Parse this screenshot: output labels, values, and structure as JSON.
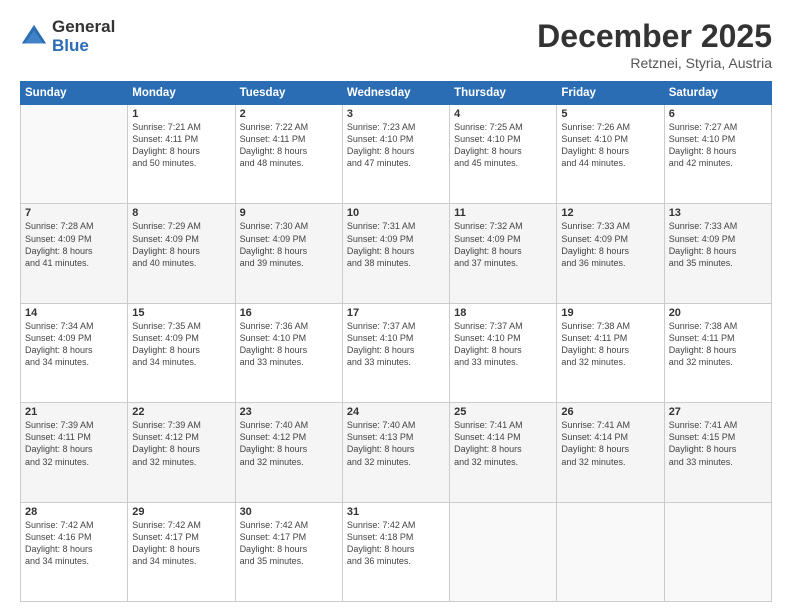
{
  "logo": {
    "general": "General",
    "blue": "Blue"
  },
  "header": {
    "month": "December 2025",
    "location": "Retznei, Styria, Austria"
  },
  "weekdays": [
    "Sunday",
    "Monday",
    "Tuesday",
    "Wednesday",
    "Thursday",
    "Friday",
    "Saturday"
  ],
  "weeks": [
    [
      {
        "day": "",
        "info": ""
      },
      {
        "day": "1",
        "info": "Sunrise: 7:21 AM\nSunset: 4:11 PM\nDaylight: 8 hours\nand 50 minutes."
      },
      {
        "day": "2",
        "info": "Sunrise: 7:22 AM\nSunset: 4:11 PM\nDaylight: 8 hours\nand 48 minutes."
      },
      {
        "day": "3",
        "info": "Sunrise: 7:23 AM\nSunset: 4:10 PM\nDaylight: 8 hours\nand 47 minutes."
      },
      {
        "day": "4",
        "info": "Sunrise: 7:25 AM\nSunset: 4:10 PM\nDaylight: 8 hours\nand 45 minutes."
      },
      {
        "day": "5",
        "info": "Sunrise: 7:26 AM\nSunset: 4:10 PM\nDaylight: 8 hours\nand 44 minutes."
      },
      {
        "day": "6",
        "info": "Sunrise: 7:27 AM\nSunset: 4:10 PM\nDaylight: 8 hours\nand 42 minutes."
      }
    ],
    [
      {
        "day": "7",
        "info": "Sunrise: 7:28 AM\nSunset: 4:09 PM\nDaylight: 8 hours\nand 41 minutes."
      },
      {
        "day": "8",
        "info": "Sunrise: 7:29 AM\nSunset: 4:09 PM\nDaylight: 8 hours\nand 40 minutes."
      },
      {
        "day": "9",
        "info": "Sunrise: 7:30 AM\nSunset: 4:09 PM\nDaylight: 8 hours\nand 39 minutes."
      },
      {
        "day": "10",
        "info": "Sunrise: 7:31 AM\nSunset: 4:09 PM\nDaylight: 8 hours\nand 38 minutes."
      },
      {
        "day": "11",
        "info": "Sunrise: 7:32 AM\nSunset: 4:09 PM\nDaylight: 8 hours\nand 37 minutes."
      },
      {
        "day": "12",
        "info": "Sunrise: 7:33 AM\nSunset: 4:09 PM\nDaylight: 8 hours\nand 36 minutes."
      },
      {
        "day": "13",
        "info": "Sunrise: 7:33 AM\nSunset: 4:09 PM\nDaylight: 8 hours\nand 35 minutes."
      }
    ],
    [
      {
        "day": "14",
        "info": "Sunrise: 7:34 AM\nSunset: 4:09 PM\nDaylight: 8 hours\nand 34 minutes."
      },
      {
        "day": "15",
        "info": "Sunrise: 7:35 AM\nSunset: 4:09 PM\nDaylight: 8 hours\nand 34 minutes."
      },
      {
        "day": "16",
        "info": "Sunrise: 7:36 AM\nSunset: 4:10 PM\nDaylight: 8 hours\nand 33 minutes."
      },
      {
        "day": "17",
        "info": "Sunrise: 7:37 AM\nSunset: 4:10 PM\nDaylight: 8 hours\nand 33 minutes."
      },
      {
        "day": "18",
        "info": "Sunrise: 7:37 AM\nSunset: 4:10 PM\nDaylight: 8 hours\nand 33 minutes."
      },
      {
        "day": "19",
        "info": "Sunrise: 7:38 AM\nSunset: 4:11 PM\nDaylight: 8 hours\nand 32 minutes."
      },
      {
        "day": "20",
        "info": "Sunrise: 7:38 AM\nSunset: 4:11 PM\nDaylight: 8 hours\nand 32 minutes."
      }
    ],
    [
      {
        "day": "21",
        "info": "Sunrise: 7:39 AM\nSunset: 4:11 PM\nDaylight: 8 hours\nand 32 minutes."
      },
      {
        "day": "22",
        "info": "Sunrise: 7:39 AM\nSunset: 4:12 PM\nDaylight: 8 hours\nand 32 minutes."
      },
      {
        "day": "23",
        "info": "Sunrise: 7:40 AM\nSunset: 4:12 PM\nDaylight: 8 hours\nand 32 minutes."
      },
      {
        "day": "24",
        "info": "Sunrise: 7:40 AM\nSunset: 4:13 PM\nDaylight: 8 hours\nand 32 minutes."
      },
      {
        "day": "25",
        "info": "Sunrise: 7:41 AM\nSunset: 4:14 PM\nDaylight: 8 hours\nand 32 minutes."
      },
      {
        "day": "26",
        "info": "Sunrise: 7:41 AM\nSunset: 4:14 PM\nDaylight: 8 hours\nand 32 minutes."
      },
      {
        "day": "27",
        "info": "Sunrise: 7:41 AM\nSunset: 4:15 PM\nDaylight: 8 hours\nand 33 minutes."
      }
    ],
    [
      {
        "day": "28",
        "info": "Sunrise: 7:42 AM\nSunset: 4:16 PM\nDaylight: 8 hours\nand 34 minutes."
      },
      {
        "day": "29",
        "info": "Sunrise: 7:42 AM\nSunset: 4:17 PM\nDaylight: 8 hours\nand 34 minutes."
      },
      {
        "day": "30",
        "info": "Sunrise: 7:42 AM\nSunset: 4:17 PM\nDaylight: 8 hours\nand 35 minutes."
      },
      {
        "day": "31",
        "info": "Sunrise: 7:42 AM\nSunset: 4:18 PM\nDaylight: 8 hours\nand 36 minutes."
      },
      {
        "day": "",
        "info": ""
      },
      {
        "day": "",
        "info": ""
      },
      {
        "day": "",
        "info": ""
      }
    ]
  ]
}
